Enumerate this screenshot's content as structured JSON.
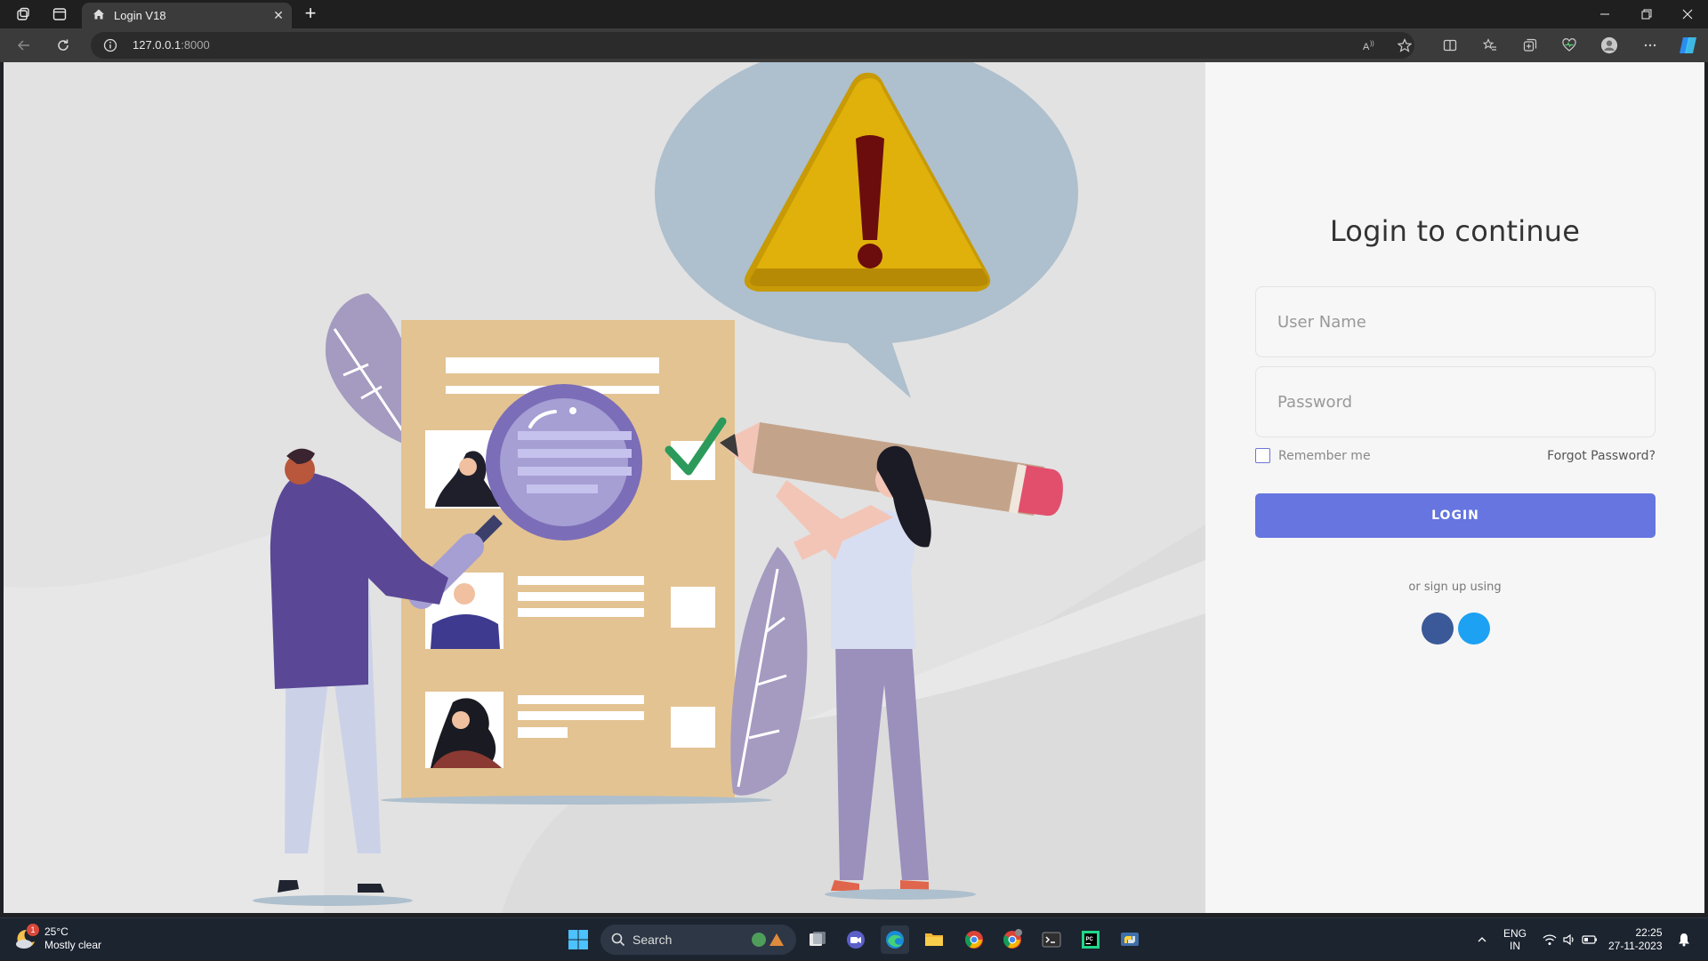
{
  "browser": {
    "tab": {
      "title": "Login V18",
      "close_icon": "close-icon"
    },
    "new_tab_label": "+",
    "address": {
      "host": "127.0.0.1",
      "port": ":8000"
    }
  },
  "login": {
    "title": "Login to continue",
    "username_placeholder": "User Name",
    "password_placeholder": "Password",
    "remember_label": "Remember me",
    "forgot_label": "Forgot Password?",
    "login_button": "LOGIN",
    "signup_text": "or sign up using",
    "social_colors": [
      "#3b5998",
      "#1da1f2"
    ]
  },
  "colors": {
    "accent": "#6675df",
    "panel_bg": "#f6f6f6",
    "hero_bg": "#e2e2e2"
  },
  "taskbar": {
    "weather": {
      "temp": "25°C",
      "condition": "Mostly clear",
      "badge": "1"
    },
    "search_label": "Search",
    "language": {
      "line1": "ENG",
      "line2": "IN"
    },
    "clock": {
      "time": "22:25",
      "date": "27-11-2023"
    }
  }
}
